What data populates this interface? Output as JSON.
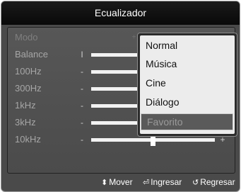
{
  "window": {
    "title": "Ecualizador"
  },
  "rows": [
    {
      "label": "Modo",
      "left_mark": "",
      "right_mark": ""
    },
    {
      "label": "Balance",
      "left_mark": "I",
      "right_mark": ""
    },
    {
      "label": "100Hz",
      "left_mark": "-",
      "right_mark": ""
    },
    {
      "label": "300Hz",
      "left_mark": "-",
      "right_mark": ""
    },
    {
      "label": "1kHz",
      "left_mark": "-",
      "right_mark": ""
    },
    {
      "label": "3kHz",
      "left_mark": "-",
      "right_mark": "+"
    },
    {
      "label": "10kHz",
      "left_mark": "-",
      "right_mark": "+"
    }
  ],
  "sliders": {
    "3kHz": {
      "level": 0.5
    },
    "10kHz": {
      "level": 0.5
    }
  },
  "mode_dropdown": {
    "options": [
      "Normal",
      "Música",
      "Cine",
      "Diálogo",
      "Favorito"
    ],
    "selected": "Favorito"
  },
  "footer": {
    "move": {
      "icon": "updown-arrow-icon",
      "label": "Mover"
    },
    "enter": {
      "icon": "enter-icon",
      "label": "Ingresar"
    },
    "back": {
      "icon": "return-icon",
      "label": "Regresar"
    }
  }
}
